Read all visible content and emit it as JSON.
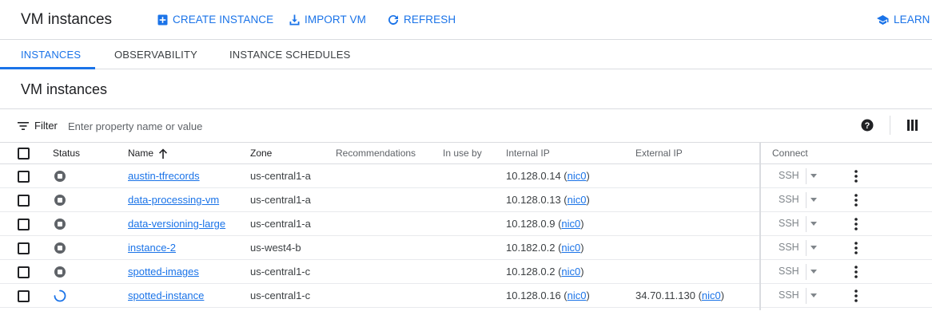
{
  "header": {
    "title": "VM instances",
    "actions": [
      {
        "label": "CREATE INSTANCE",
        "icon": "add-box-icon"
      },
      {
        "label": "IMPORT VM",
        "icon": "download-icon"
      },
      {
        "label": "REFRESH",
        "icon": "refresh-icon"
      }
    ],
    "learn": {
      "label": "LEARN",
      "icon": "school-icon"
    }
  },
  "tabs": [
    {
      "label": "INSTANCES",
      "active": true
    },
    {
      "label": "OBSERVABILITY",
      "active": false
    },
    {
      "label": "INSTANCE SCHEDULES",
      "active": false
    }
  ],
  "section_title": "VM instances",
  "filter": {
    "label": "Filter",
    "placeholder": "Enter property name or value"
  },
  "columns": {
    "status": "Status",
    "name": "Name",
    "zone": "Zone",
    "recommendations": "Recommendations",
    "in_use_by": "In use by",
    "internal_ip": "Internal IP",
    "external_ip": "External IP",
    "connect": "Connect"
  },
  "rows": [
    {
      "status": "stopped",
      "name": "austin-tfrecords",
      "zone": "us-central1-a",
      "internal_ip": "10.128.0.14",
      "internal_nic": "nic0",
      "external_ip": "",
      "external_nic": "",
      "connect": "SSH"
    },
    {
      "status": "stopped",
      "name": "data-processing-vm",
      "zone": "us-central1-a",
      "internal_ip": "10.128.0.13",
      "internal_nic": "nic0",
      "external_ip": "",
      "external_nic": "",
      "connect": "SSH"
    },
    {
      "status": "stopped",
      "name": "data-versioning-large",
      "zone": "us-central1-a",
      "internal_ip": "10.128.0.9",
      "internal_nic": "nic0",
      "external_ip": "",
      "external_nic": "",
      "connect": "SSH"
    },
    {
      "status": "stopped",
      "name": "instance-2",
      "zone": "us-west4-b",
      "internal_ip": "10.182.0.2",
      "internal_nic": "nic0",
      "external_ip": "",
      "external_nic": "",
      "connect": "SSH"
    },
    {
      "status": "stopped",
      "name": "spotted-images",
      "zone": "us-central1-c",
      "internal_ip": "10.128.0.2",
      "internal_nic": "nic0",
      "external_ip": "",
      "external_nic": "",
      "connect": "SSH"
    },
    {
      "status": "starting",
      "name": "spotted-instance",
      "zone": "us-central1-c",
      "internal_ip": "10.128.0.16",
      "internal_nic": "nic0",
      "external_ip": "34.70.11.130",
      "external_nic": "nic0",
      "connect": "SSH"
    }
  ],
  "colors": {
    "accent": "#1a73e8",
    "text": "#202124",
    "muted": "#5f6368",
    "border": "#dadce0"
  }
}
